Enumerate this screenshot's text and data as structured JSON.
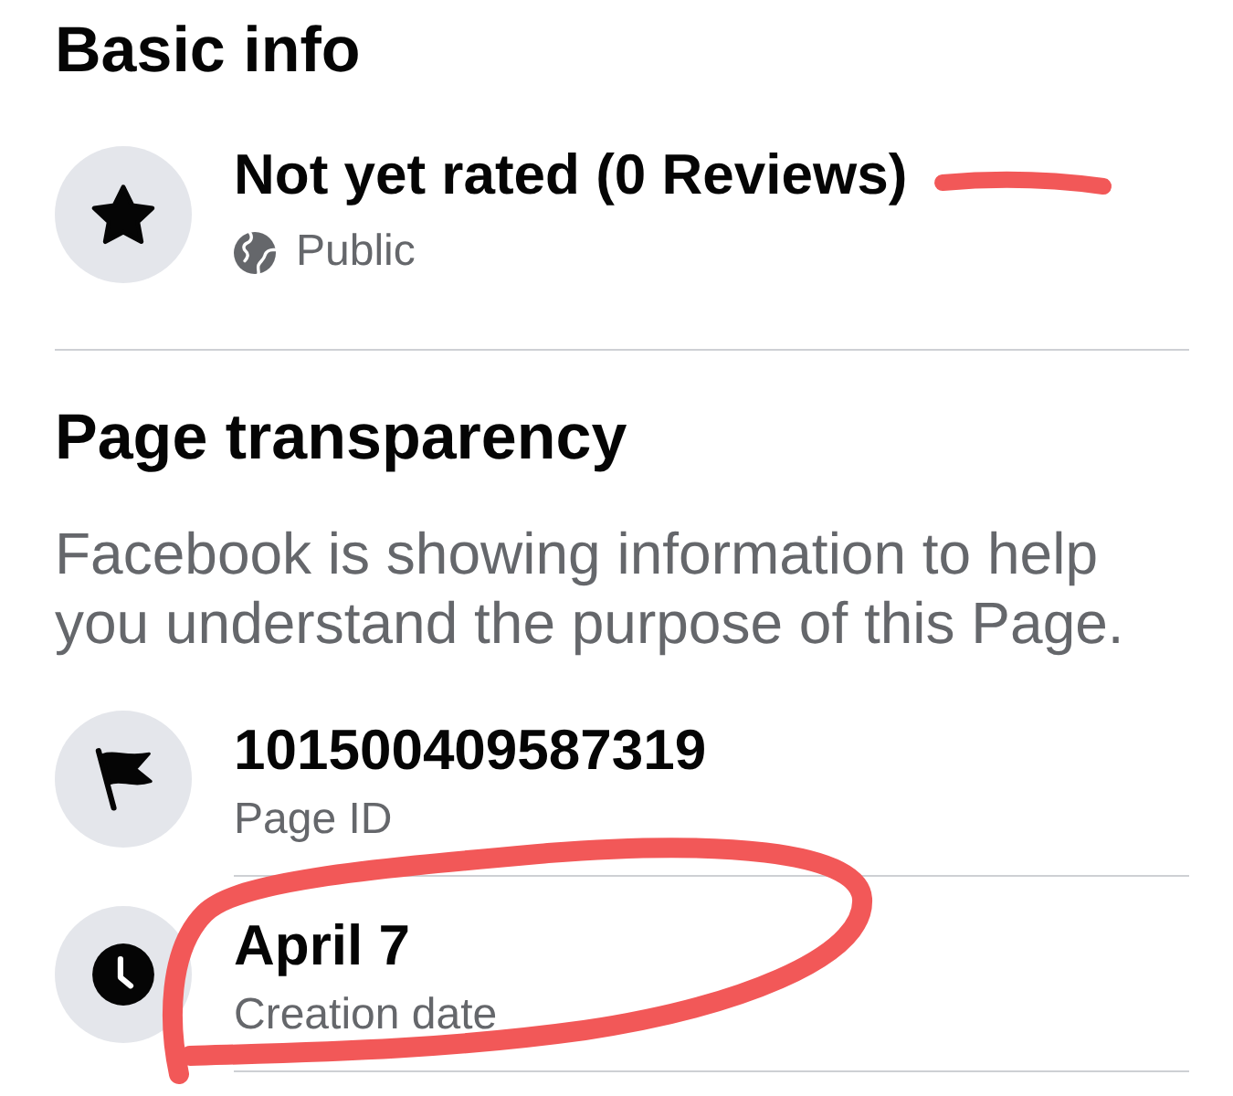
{
  "sections": [
    {
      "title": "Basic info",
      "items": [
        {
          "kind": "rating",
          "title": "Not yet rated (0 Reviews)",
          "subtitle": "Public"
        }
      ]
    },
    {
      "title": "Page transparency",
      "description": "Facebook is showing information to help you understand the purpose of this Page.",
      "items": [
        {
          "kind": "id",
          "title": "101500409587319",
          "subtitle": "Page ID"
        },
        {
          "kind": "date",
          "title": "April 7",
          "subtitle": "Creation date"
        }
      ]
    }
  ]
}
